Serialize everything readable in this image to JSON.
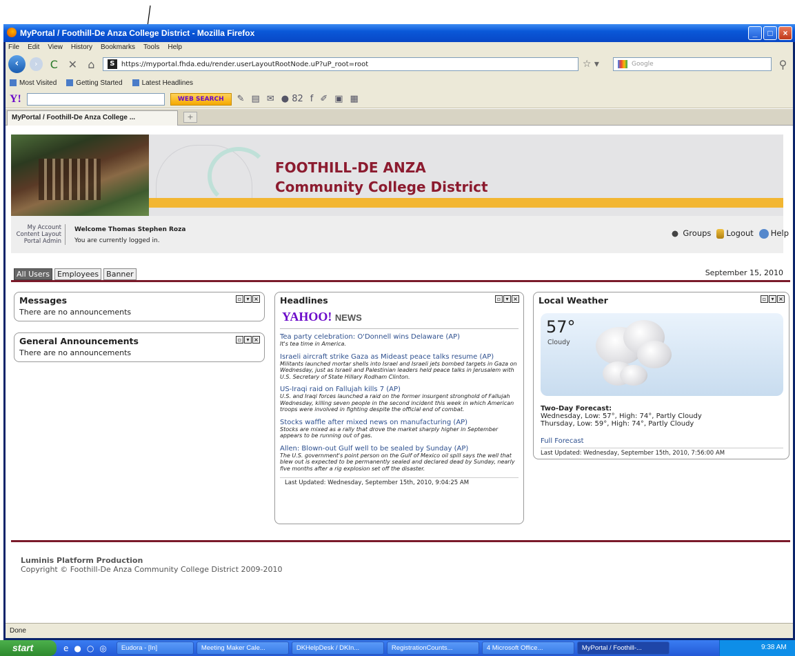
{
  "window": {
    "title": "MyPortal / Foothill-De Anza College District - Mozilla Firefox"
  },
  "menu": [
    "File",
    "Edit",
    "View",
    "History",
    "Bookmarks",
    "Tools",
    "Help"
  ],
  "nav": {
    "url": "https://myportal.fhda.edu/render.userLayoutRootNode.uP?uP_root=root",
    "search_placeholder": "Google"
  },
  "bookmarks": [
    "Most Visited",
    "Getting Started",
    "Latest Headlines"
  ],
  "yahoo_toolbar": {
    "search_button": "WEB SEARCH",
    "count": "82"
  },
  "browser_tab": {
    "label": "MyPortal / Foothill-De Anza College ..."
  },
  "portal": {
    "district_line1": "FOOTHILL-DE ANZA",
    "district_line2": "Community College District",
    "account_links": [
      "My Account",
      "Content Layout",
      "Portal Admin"
    ],
    "welcome": "Welcome Thomas Stephen Roza",
    "login_status": "You are currently logged in.",
    "right_links": [
      "Groups",
      "Logout",
      "Help"
    ],
    "tabs": [
      "All Users",
      "Employees",
      "Banner"
    ],
    "date": "September 15, 2010"
  },
  "messages": {
    "title": "Messages",
    "text": "There are no announcements"
  },
  "general": {
    "title": "General Announcements",
    "text": "There are no announcements"
  },
  "headlines": {
    "title": "Headlines",
    "brand": "YAHOO!",
    "brand_suffix": "NEWS",
    "items": [
      {
        "title": "Tea party celebration: O'Donnell wins Delaware (AP)",
        "desc": "It's tea time in America."
      },
      {
        "title": "Israeli aircraft strike Gaza as Mideast peace talks resume (AP)",
        "desc": "Militants launched mortar shells into Israel and Israeli jets bombed targets in Gaza on Wednesday, just as Israeli and Palestinian leaders held peace talks in Jerusalem with U.S. Secretary of State Hillary Rodham Clinton."
      },
      {
        "title": "US-Iraqi raid on Fallujah kills 7 (AP)",
        "desc": "U.S. and Iraqi forces launched a raid on the former insurgent stronghold of Fallujah Wednesday, killing seven people in the second incident this week in which American troops were involved in fighting despite the official end of combat."
      },
      {
        "title": "Stocks waffle after mixed news on manufacturing (AP)",
        "desc": "Stocks are mixed as a rally that drove the market sharply higher in September appears to be running out of gas."
      },
      {
        "title": "Allen: Blown-out Gulf well to be sealed by Sunday (AP)",
        "desc": "The U.S. government's point person on the Gulf of Mexico oil spill says the well that blew out is expected to be permanently sealed and declared dead by Sunday, nearly five months after a rig explosion set off the disaster."
      }
    ],
    "updated_label": "Last Updated:",
    "updated": "Wednesday, September 15th, 2010, 9:04:25 AM"
  },
  "weather": {
    "title": "Local Weather",
    "temp": "57°",
    "condition": "Cloudy",
    "forecast_label": "Two-Day Forecast:",
    "day1": "Wednesday, Low: 57°, High: 74°, Partly Cloudy",
    "day2": "Thursday, Low: 59°, High: 74°, Partly Cloudy",
    "full_link": "Full Forecast",
    "updated_label": "Last Updated:",
    "updated": "Wednesday, September 15th, 2010, 7:56:00 AM"
  },
  "footer": {
    "line1": "Luminis Platform Production",
    "line2": "Copyright © Foothill-De Anza Community College District 2009-2010"
  },
  "statusbar": "Done",
  "taskbar": {
    "start": "start",
    "buttons": [
      "Eudora - [In]",
      "Meeting Maker Cale...",
      "DKHelpDesk / DKIn...",
      "RegistrationCounts...",
      "4 Microsoft Office...",
      "MyPortal / Foothill-..."
    ],
    "time": "9:38 AM"
  }
}
